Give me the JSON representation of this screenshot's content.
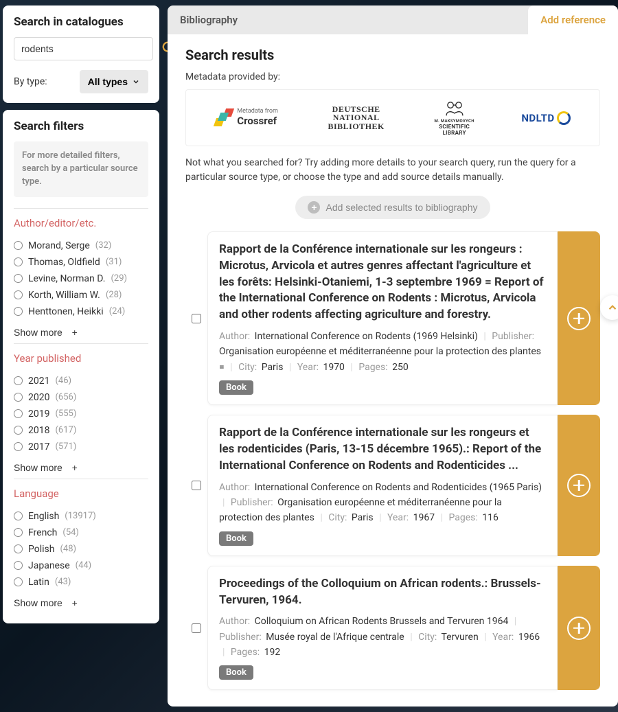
{
  "search_panel": {
    "title": "Search in catalogues",
    "query": "rodents",
    "by_type_label": "By type:",
    "type_value": "All types"
  },
  "filters_panel": {
    "title": "Search filters",
    "hint": "For more detailed filters, search by a particular source type.",
    "show_more": "Show more",
    "sections": [
      {
        "title": "Author/editor/etc.",
        "items": [
          {
            "label": "Morand, Serge",
            "count": "(32)"
          },
          {
            "label": "Thomas, Oldfield",
            "count": "(31)"
          },
          {
            "label": "Levine, Norman D.",
            "count": "(29)"
          },
          {
            "label": "Korth, William W.",
            "count": "(28)"
          },
          {
            "label": "Henttonen, Heikki",
            "count": "(24)"
          }
        ]
      },
      {
        "title": "Year published",
        "items": [
          {
            "label": "2021",
            "count": "(46)"
          },
          {
            "label": "2020",
            "count": "(656)"
          },
          {
            "label": "2019",
            "count": "(555)"
          },
          {
            "label": "2018",
            "count": "(617)"
          },
          {
            "label": "2017",
            "count": "(571)"
          }
        ]
      },
      {
        "title": "Language",
        "items": [
          {
            "label": "English",
            "count": "(13917)"
          },
          {
            "label": "French",
            "count": "(54)"
          },
          {
            "label": "Polish",
            "count": "(48)"
          },
          {
            "label": "Japanese",
            "count": "(44)"
          },
          {
            "label": "Latin",
            "count": "(43)"
          }
        ]
      }
    ]
  },
  "tabs": {
    "bibliography": "Bibliography",
    "add_reference": "Add reference"
  },
  "results": {
    "heading": "Search results",
    "metadata_label": "Metadata provided by:",
    "providers": {
      "crossref_pre": "Metadata from",
      "crossref": "Crossref",
      "dnb_l1": "DEUTSCHE",
      "dnb_l2": "NATIONAL",
      "dnb_l3": "BIBLIOTHEK",
      "scilib_l1": "M. MAKSYMOVYCH",
      "scilib_l2": "SCIENTIFIC",
      "scilib_l3": "LIBRARY",
      "ndltd": "NDLTD"
    },
    "hint": "Not what you searched for? Try adding more details to your search query, run the query for a particular source type, or choose the type and add source details manually.",
    "add_selected": "Add selected results to bibliography",
    "items": [
      {
        "title": "Rapport de la Conférence internationale sur les rongeurs : Microtus, Arvicola et autres genres affectant l'agriculture et les forêts: Helsinki-Otaniemi, 1-3 septembre 1969 = Report of the International Conference on Rodents : Microtus, Arvicola and other rodents affecting agriculture and forestry.",
        "author": "International Conference on Rodents (1969 Helsinki)",
        "publisher": "Organisation européenne et méditerranéenne pour la protection des plantes =",
        "city": "Paris",
        "year": "1970",
        "pages": "250",
        "type": "Book"
      },
      {
        "title": "Rapport de la Conférence internationale sur les rongeurs et les rodenticides (Paris, 13-15 décembre 1965).: Report of the International Conference on Rodents and Rodenticides ...",
        "author": "International Conference on Rodents and Rodenticides (1965 Paris)",
        "publisher": "Organisation européenne et méditerranéenne pour la protection des plantes",
        "city": "Paris",
        "year": "1967",
        "pages": "116",
        "type": "Book"
      },
      {
        "title": "Proceedings of the Colloquium on African rodents.: Brussels-Tervuren, 1964.",
        "author": "Colloquium on African Rodents Brussels and Tervuren 1964",
        "publisher": "Musée royal de l'Afrique centrale",
        "city": "Tervuren",
        "year": "1966",
        "pages": "192",
        "type": "Book"
      }
    ]
  },
  "labels": {
    "author": "Author:",
    "publisher": "Publisher:",
    "city": "City:",
    "year": "Year:",
    "pages": "Pages:"
  }
}
